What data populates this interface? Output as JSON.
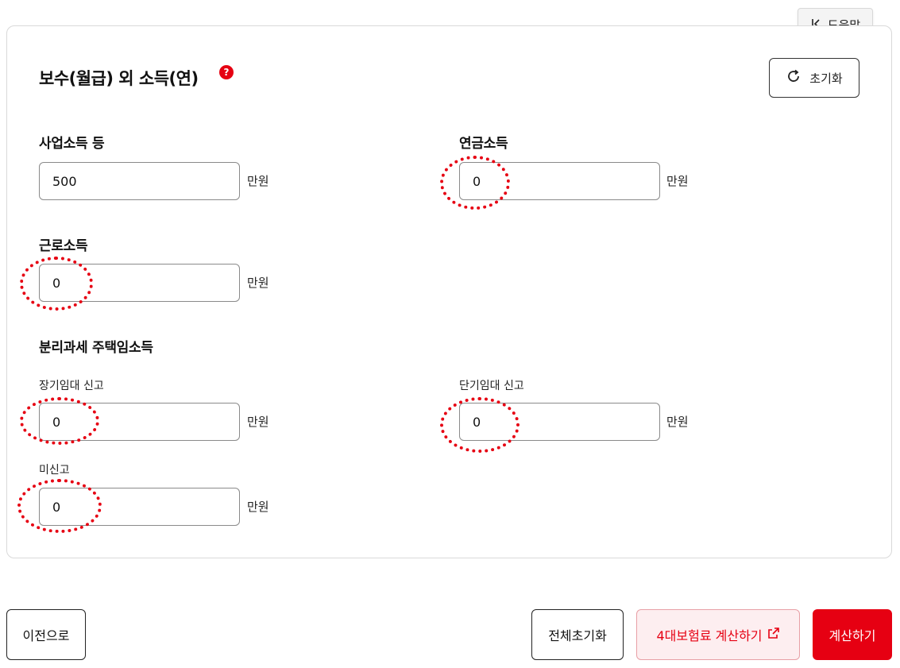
{
  "help_tab": {
    "label": "도움말",
    "icon": "collapse-left-icon"
  },
  "section": {
    "title": "보수(월급) 외 소득(연)",
    "help_badge": "?",
    "reset_label": "초기화",
    "reset_icon": "refresh-icon"
  },
  "fields": {
    "business": {
      "label": "사업소득 등",
      "value": "500",
      "unit": "만원"
    },
    "pension": {
      "label": "연금소득",
      "value": "0",
      "unit": "만원"
    },
    "labor": {
      "label": "근로소득",
      "value": "0",
      "unit": "만원"
    },
    "housing": {
      "label": "분리과세 주택임소득",
      "long_term": {
        "label": "장기임대 신고",
        "value": "0",
        "unit": "만원"
      },
      "short_term": {
        "label": "단기임대 신고",
        "value": "0",
        "unit": "만원"
      },
      "unreported": {
        "label": "미신고",
        "value": "0",
        "unit": "만원"
      }
    }
  },
  "footer": {
    "prev_label": "이전으로",
    "reset_all_label": "전체초기화",
    "insurance_label": "4대보험료 계산하기",
    "insurance_icon": "external-link-icon",
    "calculate_label": "계산하기"
  },
  "colors": {
    "accent": "#e60012",
    "accent_light": "#fdeef0",
    "border": "#8a8a8a"
  }
}
